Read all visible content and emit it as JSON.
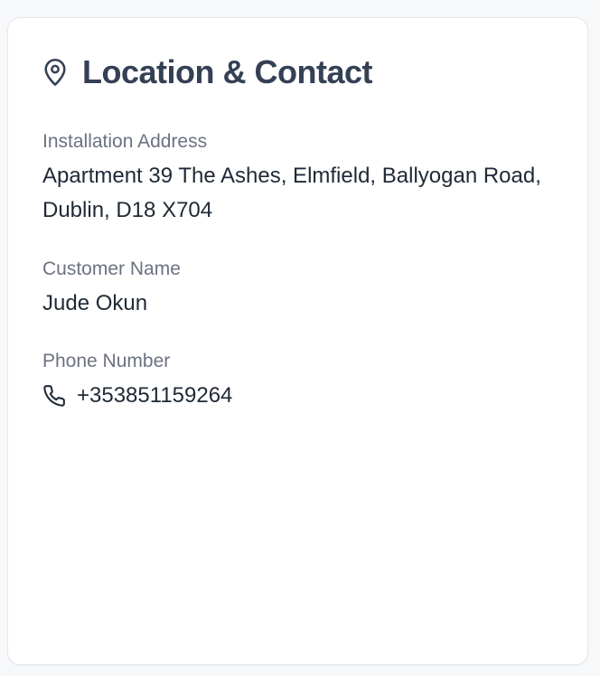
{
  "card": {
    "title": "Location & Contact",
    "header_icon": "map-pin-icon"
  },
  "fields": {
    "address": {
      "label": "Installation Address",
      "value": "Apartment 39 The Ashes, Elmfield, Ballyogan Road, Dublin, D18 X704"
    },
    "customer_name": {
      "label": "Customer Name",
      "value": "Jude Okun"
    },
    "phone": {
      "label": "Phone Number",
      "value": "+353851159264",
      "icon": "phone-icon"
    }
  },
  "colors": {
    "title": "#344054",
    "label": "#6b7280",
    "value": "#1f2937",
    "border": "#e4e7ec",
    "background": "#f7f8fa"
  }
}
